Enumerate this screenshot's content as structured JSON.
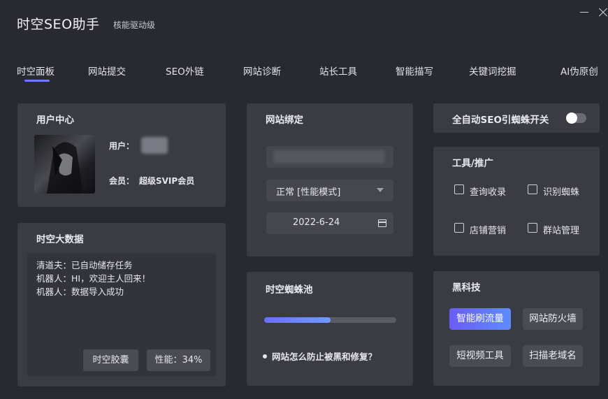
{
  "app": {
    "title": "时空SEO助手",
    "subtitle": "核能驱动级"
  },
  "tabs": [
    {
      "label": "时空面板",
      "active": true
    },
    {
      "label": "网站提交"
    },
    {
      "label": "SEO外链"
    },
    {
      "label": "网站诊断"
    },
    {
      "label": "站长工具"
    },
    {
      "label": "智能描写"
    },
    {
      "label": "关键词挖掘"
    },
    {
      "label": "AI伪原创"
    }
  ],
  "user_center": {
    "title": "用户中心",
    "user_label": "用户：",
    "member_label": "会员：",
    "member_value": "超级SVIP会员"
  },
  "big_data": {
    "title": "时空大数据",
    "logs": [
      "清道夫：已自动储存任务",
      "机器人：HI，欢迎主人回来！",
      "机器人：数据导入成功"
    ],
    "capsule_button": "时空胶囊",
    "performance": "性能：34%"
  },
  "site_binding": {
    "title": "网站绑定",
    "mode_select": "正常 [性能模式]",
    "date": "2022-6-24"
  },
  "spider_pool": {
    "title": "时空蜘蛛池",
    "progress": 0.5,
    "link_text": "网站怎么防止被黑和修复？"
  },
  "auto_spider": {
    "label": "全自动SEO引蜘蛛开关",
    "enabled": false
  },
  "tools": {
    "title": "工具/推广",
    "items": [
      "查询收录",
      "识别蜘蛛",
      "店铺营销",
      "群站管理"
    ]
  },
  "black_tech": {
    "title": "黑科技",
    "buttons": [
      "智能刷流量",
      "网站防火墙",
      "短视频工具",
      "扫描老域名"
    ]
  },
  "colors": {
    "accent": "#6c7bff",
    "panel": "#3a3b43",
    "background": "#292a31"
  }
}
